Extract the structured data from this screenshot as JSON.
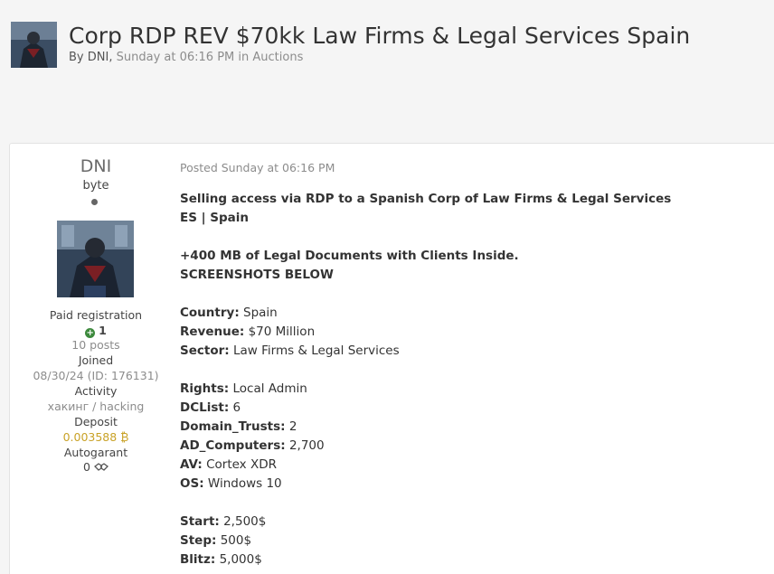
{
  "topic": {
    "title": "Corp RDP REV $70kk Law Firms & Legal Services Spain",
    "by_label": "By",
    "author": "DNI",
    "date": "Sunday at 06:16 PM",
    "in_label": "in",
    "forum": "Auctions"
  },
  "author": {
    "name": "DNI",
    "rank": "byte",
    "group": "Paid registration",
    "reputation": "1",
    "posts": "10 posts",
    "joined_label": "Joined",
    "joined_value": "08/30/24 (ID: 176131)",
    "activity_label": "Activity",
    "activity_value": "хакинг / hacking",
    "deposit_label": "Deposit",
    "deposit_value": "0.003588 ₿",
    "autogarant_label": "Autogarant",
    "autogarant_value": "0"
  },
  "post": {
    "posted": "Posted Sunday at 06:16 PM",
    "lines": [
      {
        "label": "",
        "value": "Selling access via RDP to a Spanish Corp of Law Firms & Legal Services",
        "bold": true
      },
      {
        "label": "",
        "value": "ES | Spain",
        "bold": true
      },
      {
        "label": "",
        "value": "+400 MB of Legal Documents with Clients Inside.",
        "bold": true
      },
      {
        "label": "",
        "value": "SCREENSHOTS BELOW",
        "bold": true
      },
      {
        "label": "Country:",
        "value": "Spain"
      },
      {
        "label": "Revenue:",
        "value": "$70 Million"
      },
      {
        "label": "Sector:",
        "value": "Law Firms & Legal Services"
      },
      {
        "label": "Rights:",
        "value": "Local Admin"
      },
      {
        "label": "DCList:",
        "value": "6"
      },
      {
        "label": "Domain_Trusts:",
        "value": "2"
      },
      {
        "label": "AD_Computers:",
        "value": "2,700"
      },
      {
        "label": "AV:",
        "value": "Cortex XDR"
      },
      {
        "label": "OS:",
        "value": "Windows 10"
      },
      {
        "label": "Start:",
        "value": "2,500$"
      },
      {
        "label": "Step:",
        "value": "500$"
      },
      {
        "label": "Blitz:",
        "value": "5,000$"
      }
    ]
  },
  "colors": {
    "muted": "#8c8c8c",
    "gold": "#c9a227",
    "rep_green": "#3d8a3d"
  }
}
